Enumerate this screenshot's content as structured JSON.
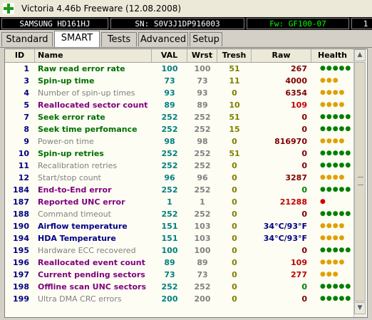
{
  "window": {
    "title": "Victoria 4.46b Freeware (12.08.2008)"
  },
  "drive": {
    "model": "SAMSUNG HD161HJ",
    "serial": "SN: S0V3J1DP916003",
    "firmware": "Fw: GF100-07",
    "extra": "1"
  },
  "tabs": [
    {
      "label": "Standard",
      "active": false
    },
    {
      "label": "SMART",
      "active": true
    },
    {
      "label": "Tests",
      "active": false
    },
    {
      "label": "Advanced",
      "active": false
    },
    {
      "label": "Setup",
      "active": false
    }
  ],
  "columns": [
    "ID",
    "Name",
    "VAL",
    "Wrst",
    "Tresh",
    "Raw",
    "Health"
  ],
  "rows": [
    {
      "id": "1",
      "name": "Raw read error rate",
      "val": "100",
      "wrst": "100",
      "tresh": "51",
      "raw": "267",
      "health": "●●●●●",
      "name_color": "green",
      "raw_color": "dark",
      "health_color": "#008000"
    },
    {
      "id": "3",
      "name": "Spin-up time",
      "val": "73",
      "wrst": "73",
      "tresh": "11",
      "raw": "4000",
      "health": "●●●",
      "name_color": "green",
      "raw_color": "dark",
      "health_color": "#e0a000"
    },
    {
      "id": "4",
      "name": "Number of spin-up times",
      "val": "93",
      "wrst": "93",
      "tresh": "0",
      "raw": "6354",
      "health": "●●●●",
      "name_color": "grey",
      "raw_color": "dark",
      "health_color": "#e0a000"
    },
    {
      "id": "5",
      "name": "Reallocated sector count",
      "val": "89",
      "wrst": "89",
      "tresh": "10",
      "raw": "109",
      "health": "●●●●",
      "name_color": "purple",
      "raw_color": "red",
      "health_color": "#e0a000"
    },
    {
      "id": "7",
      "name": "Seek error rate",
      "val": "252",
      "wrst": "252",
      "tresh": "51",
      "raw": "0",
      "health": "●●●●●",
      "name_color": "green",
      "raw_color": "dark",
      "health_color": "#008000"
    },
    {
      "id": "8",
      "name": "Seek time perfomance",
      "val": "252",
      "wrst": "252",
      "tresh": "15",
      "raw": "0",
      "health": "●●●●●",
      "name_color": "green",
      "raw_color": "dark",
      "health_color": "#008000"
    },
    {
      "id": "9",
      "name": "Power-on time",
      "val": "98",
      "wrst": "98",
      "tresh": "0",
      "raw": "816970",
      "health": "●●●●",
      "name_color": "grey",
      "raw_color": "dark",
      "health_color": "#e0a000"
    },
    {
      "id": "10",
      "name": "Spin-up retries",
      "val": "252",
      "wrst": "252",
      "tresh": "51",
      "raw": "0",
      "health": "●●●●●",
      "name_color": "green",
      "raw_color": "dark",
      "health_color": "#008000"
    },
    {
      "id": "11",
      "name": "Recalibration retries",
      "val": "252",
      "wrst": "252",
      "tresh": "0",
      "raw": "0",
      "health": "●●●●●",
      "name_color": "grey",
      "raw_color": "dark",
      "health_color": "#008000"
    },
    {
      "id": "12",
      "name": "Start/stop count",
      "val": "96",
      "wrst": "96",
      "tresh": "0",
      "raw": "3287",
      "health": "●●●●",
      "name_color": "grey",
      "raw_color": "dark",
      "health_color": "#e0a000"
    },
    {
      "id": "184",
      "name": "End-to-End error",
      "val": "252",
      "wrst": "252",
      "tresh": "0",
      "raw": "0",
      "health": "●●●●●",
      "name_color": "purple",
      "raw_color": "green",
      "health_color": "#008000"
    },
    {
      "id": "187",
      "name": "Reported UNC error",
      "val": "1",
      "wrst": "1",
      "tresh": "0",
      "raw": "21288",
      "health": "●",
      "name_color": "purple",
      "raw_color": "red",
      "health_color": "#d00000"
    },
    {
      "id": "188",
      "name": "Command timeout",
      "val": "252",
      "wrst": "252",
      "tresh": "0",
      "raw": "0",
      "health": "●●●●●",
      "name_color": "grey",
      "raw_color": "dark",
      "health_color": "#008000"
    },
    {
      "id": "190",
      "name": "Airflow temperature",
      "val": "151",
      "wrst": "103",
      "tresh": "0",
      "raw": "34°C/93°F",
      "health": "●●●●",
      "name_color": "blue",
      "raw_color": "blue",
      "health_color": "#e0a000"
    },
    {
      "id": "194",
      "name": "HDA Temperature",
      "val": "151",
      "wrst": "103",
      "tresh": "0",
      "raw": "34°C/93°F",
      "health": "●●●●",
      "name_color": "blue",
      "raw_color": "blue",
      "health_color": "#e0a000"
    },
    {
      "id": "195",
      "name": "Hardware ECC recovered",
      "val": "100",
      "wrst": "100",
      "tresh": "0",
      "raw": "0",
      "health": "●●●●●",
      "name_color": "grey",
      "raw_color": "dark",
      "health_color": "#008000"
    },
    {
      "id": "196",
      "name": "Reallocated event count",
      "val": "89",
      "wrst": "89",
      "tresh": "0",
      "raw": "109",
      "health": "●●●●",
      "name_color": "purple",
      "raw_color": "red",
      "health_color": "#e0a000"
    },
    {
      "id": "197",
      "name": "Current pending sectors",
      "val": "73",
      "wrst": "73",
      "tresh": "0",
      "raw": "277",
      "health": "●●●",
      "name_color": "purple",
      "raw_color": "red",
      "health_color": "#e0a000"
    },
    {
      "id": "198",
      "name": "Offline scan UNC sectors",
      "val": "252",
      "wrst": "252",
      "tresh": "0",
      "raw": "0",
      "health": "●●●●●",
      "name_color": "purple",
      "raw_color": "green",
      "health_color": "#008000"
    },
    {
      "id": "199",
      "name": "Ultra DMA CRC errors",
      "val": "200",
      "wrst": "200",
      "tresh": "0",
      "raw": "0",
      "health": "●●●●●",
      "name_color": "grey",
      "raw_color": "dark",
      "health_color": "#008000"
    }
  ]
}
